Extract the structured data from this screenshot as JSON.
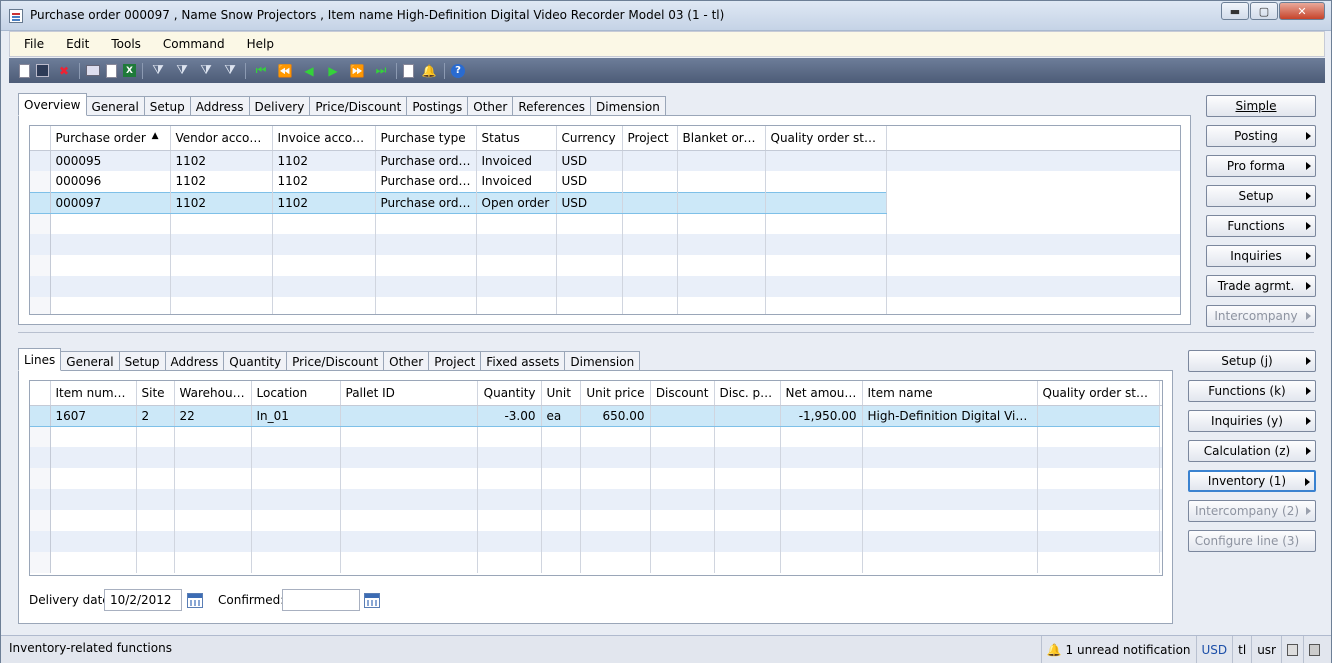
{
  "window": {
    "title": "Purchase order 000097 , Name Snow Projectors , Item name High-Definition Digital Video Recorder Model 03 (1 - tl)",
    "min_label": "▬",
    "max_label": "▢",
    "close_label": "✕"
  },
  "menu": [
    "File",
    "Edit",
    "Tools",
    "Command",
    "Help"
  ],
  "toolbar_icons": [
    "new-icon",
    "save-icon",
    "delete-icon",
    "print-icon",
    "print-preview-icon",
    "excel-icon",
    "filter-by-selection-icon",
    "filter-by-grid-icon",
    "advanced-filter-icon",
    "remove-filter-icon",
    "first-record-icon",
    "previous-page-icon",
    "previous-record-icon",
    "next-record-icon",
    "next-page-icon",
    "last-record-icon",
    "document-handling-icon",
    "alert-icon",
    "help-icon"
  ],
  "header_tabs": [
    "Overview",
    "General",
    "Setup",
    "Address",
    "Delivery",
    "Price/Discount",
    "Postings",
    "Other",
    "References",
    "Dimension"
  ],
  "header_grid": {
    "columns": [
      "Purchase order",
      "Vendor account",
      "Invoice account",
      "Purchase type",
      "Status",
      "Currency",
      "Project",
      "Blanket order",
      "Quality order status"
    ],
    "sort_indicator": "▲",
    "rows": [
      [
        "000095",
        "1102",
        "1102",
        "Purchase order",
        "Invoiced",
        "USD",
        "",
        "",
        ""
      ],
      [
        "000096",
        "1102",
        "1102",
        "Purchase order",
        "Invoiced",
        "USD",
        "",
        "",
        ""
      ],
      [
        "000097",
        "1102",
        "1102",
        "Purchase order",
        "Open order",
        "USD",
        "",
        "",
        ""
      ]
    ]
  },
  "header_buttons": [
    {
      "label": "Simple",
      "arrow": false,
      "disabled": false
    },
    {
      "label": "Posting",
      "arrow": true,
      "disabled": false
    },
    {
      "label": "Pro forma",
      "arrow": true,
      "disabled": false
    },
    {
      "label": "Setup",
      "arrow": true,
      "disabled": false
    },
    {
      "label": "Functions",
      "arrow": true,
      "disabled": false
    },
    {
      "label": "Inquiries",
      "arrow": true,
      "disabled": false
    },
    {
      "label": "Trade agrmt.",
      "arrow": true,
      "disabled": false
    },
    {
      "label": "Intercompany",
      "arrow": true,
      "disabled": true
    }
  ],
  "line_tabs": [
    "Lines",
    "General",
    "Setup",
    "Address",
    "Quantity",
    "Price/Discount",
    "Other",
    "Project",
    "Fixed assets",
    "Dimension"
  ],
  "line_grid": {
    "columns": [
      "Item number",
      "Site",
      "Warehouse",
      "Location",
      "Pallet ID",
      "Quantity",
      "Unit",
      "Unit price",
      "Discount",
      "Disc. pct.",
      "Net amount",
      "Item name",
      "Quality order status"
    ],
    "rows": [
      [
        "1607",
        "2",
        "22",
        "In_01",
        "",
        "-3.00",
        "ea",
        "650.00",
        "",
        "",
        "-1,950.00",
        "High-Definition Digital Video...",
        ""
      ]
    ]
  },
  "line_buttons": [
    {
      "label": "Setup (j)",
      "arrow": true,
      "disabled": false,
      "focus": false
    },
    {
      "label": "Functions (k)",
      "arrow": true,
      "disabled": false,
      "focus": false
    },
    {
      "label": "Inquiries (y)",
      "arrow": true,
      "disabled": false,
      "focus": false
    },
    {
      "label": "Calculation (z)",
      "arrow": true,
      "disabled": false,
      "focus": false
    },
    {
      "label": "Inventory (1)",
      "arrow": true,
      "disabled": false,
      "focus": true
    },
    {
      "label": "Intercompany (2)",
      "arrow": true,
      "disabled": true,
      "focus": false
    },
    {
      "label": "Configure line (3)",
      "arrow": false,
      "disabled": true,
      "focus": false
    }
  ],
  "delivery": {
    "date_label": "Delivery date:",
    "date_value": "10/2/2012",
    "confirmed_label": "Confirmed:",
    "confirmed_value": ""
  },
  "status": {
    "text": "Inventory-related functions",
    "notification": "1 unread notification",
    "currency": "USD",
    "company": "tl",
    "layer": "usr"
  }
}
